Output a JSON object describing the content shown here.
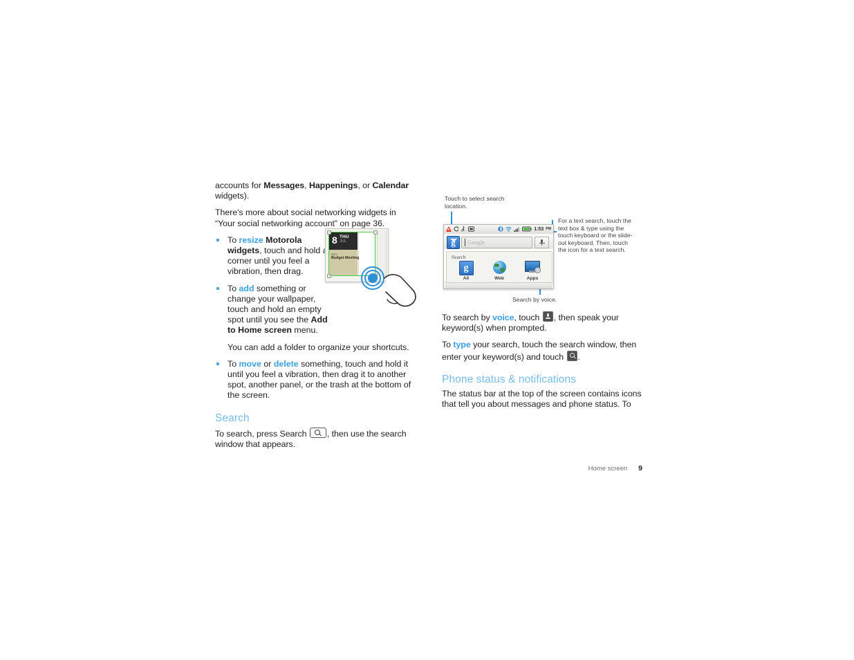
{
  "left_column": {
    "paragraph_1": {
      "pre": "accounts for ",
      "bold_1": "Messages",
      "mid_1": ", ",
      "bold_2": "Happenings",
      "mid_2": ", or ",
      "bold_3": "Calendar",
      "post": "widgets)."
    },
    "paragraph_2": "There's more about social networking widgets in “Your social networking account” on page 36.",
    "bullets": [
      {
        "pre": "To ",
        "link": "resize",
        "mid": " ",
        "bold_1": "Motorola widgets",
        "post": ", touch and hold a corner until you feel a vibration, then drag."
      },
      {
        "pre": "To ",
        "link": "add",
        "mid": " something or change your wallpaper, touch and hold an empty spot until you see the ",
        "bold_1": "Add to Home screen",
        "post": " menu."
      },
      {
        "pre": "To ",
        "link": "move",
        "mid": " or ",
        "link_2": "delete",
        "post": " something, touch and hold it until you feel a vibration, then drag it to another spot, another panel, or the trash at the bottom of the screen."
      }
    ],
    "folder_note": "You can add a folder to organize your shortcuts.",
    "search_heading": "Search",
    "search_paragraph": {
      "pre": "To search, press Search ",
      "post": ", then use the search window that appears."
    }
  },
  "widget_figure": {
    "day_number": "8",
    "day_of_week": "THU",
    "month": "JUL",
    "event_time": "3pm",
    "event_title": "Budget Meeting"
  },
  "search_figure": {
    "callout_top": "Touch to select search location.",
    "callout_right": "For a text search, touch the text box & type using the touch keyboard or the slide-out keyboard. Then, touch the icon for a text search.",
    "callout_bottom": "Search by voice.",
    "status_bar": {
      "time": "1:53",
      "ampm": "PM",
      "icons": [
        "alert-icon",
        "sync-icon",
        "usb-icon",
        "sd-card-icon",
        "bluetooth-icon",
        "wifi-icon",
        "signal-icon",
        "battery-icon"
      ]
    },
    "google_button_label": "g",
    "search_placeholder": "Google",
    "panel_label": "Search",
    "tiles": [
      {
        "label": "All",
        "icon": "google-g-icon"
      },
      {
        "label": "Web",
        "icon": "globe-icon"
      },
      {
        "label": "Apps",
        "icon": "monitor-gear-icon"
      }
    ]
  },
  "right_column": {
    "paragraph_voice": {
      "pre": "To search by ",
      "link": "voice",
      "mid": ", touch ",
      "post": ", then speak your keyword(s) when prompted."
    },
    "paragraph_type": {
      "pre": "To ",
      "link": "type",
      "mid": " your search, touch the search window, then enter your keyword(s) and touch ",
      "post": "."
    },
    "status_heading": "Phone status & notifications",
    "status_paragraph": "The status bar at the top of the screen contains icons that tell you about messages and phone status. To"
  },
  "footer": {
    "chapter": "Home screen",
    "page_number": "9"
  },
  "colors": {
    "heading_blue": "#76bdec",
    "link_blue": "#3c9fe0",
    "leader_blue": "#2d8fd8",
    "body_text": "#231f20",
    "widget_green": "#44cc44"
  }
}
